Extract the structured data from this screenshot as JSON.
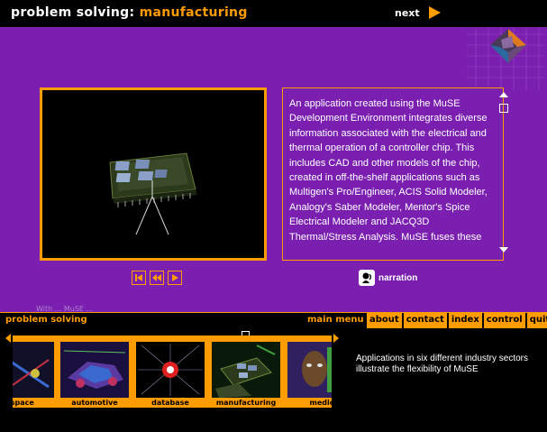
{
  "header": {
    "title_prefix": "problem solving:",
    "title_topic": "manufacturing",
    "next_label": "next"
  },
  "main": {
    "description": "An application created using the MuSE Development Environment integrates diverse information associated with the electrical and thermal operation of a controller chip. This includes CAD and other models of the chip, created in off-the-shelf applications such as Multigen's Pro/Engineer, ACIS Solid Modeler, Analogy's Saber Modeler, Mentor's Spice Electrical Modeler and JACQ3D Thermal/Stress Analysis. MuSE fuses these",
    "narration_label": "narration",
    "faded_caption": "With ... MuSE ..."
  },
  "navbar": {
    "section_label": "problem solving",
    "main_menu_label": "main menu",
    "tabs": [
      {
        "label": "about"
      },
      {
        "label": "contact"
      },
      {
        "label": "index"
      },
      {
        "label": "control"
      },
      {
        "label": "quit"
      }
    ]
  },
  "carousel": {
    "items": [
      {
        "label": "ospace"
      },
      {
        "label": "automotive"
      },
      {
        "label": "database"
      },
      {
        "label": "manufacturing"
      },
      {
        "label": "medic"
      }
    ],
    "description": "Applications in six different industry sectors illustrate the flexibility of MuSE"
  },
  "colors": {
    "accent": "#ff9c00",
    "background": "#7a1fb0",
    "bar": "#000000"
  },
  "icons": [
    "next-arrow-icon",
    "scroll-up-icon",
    "scroll-down-icon",
    "first-icon",
    "rewind-icon",
    "play-icon",
    "narration-icon",
    "carousel-left-icon",
    "carousel-right-icon"
  ]
}
